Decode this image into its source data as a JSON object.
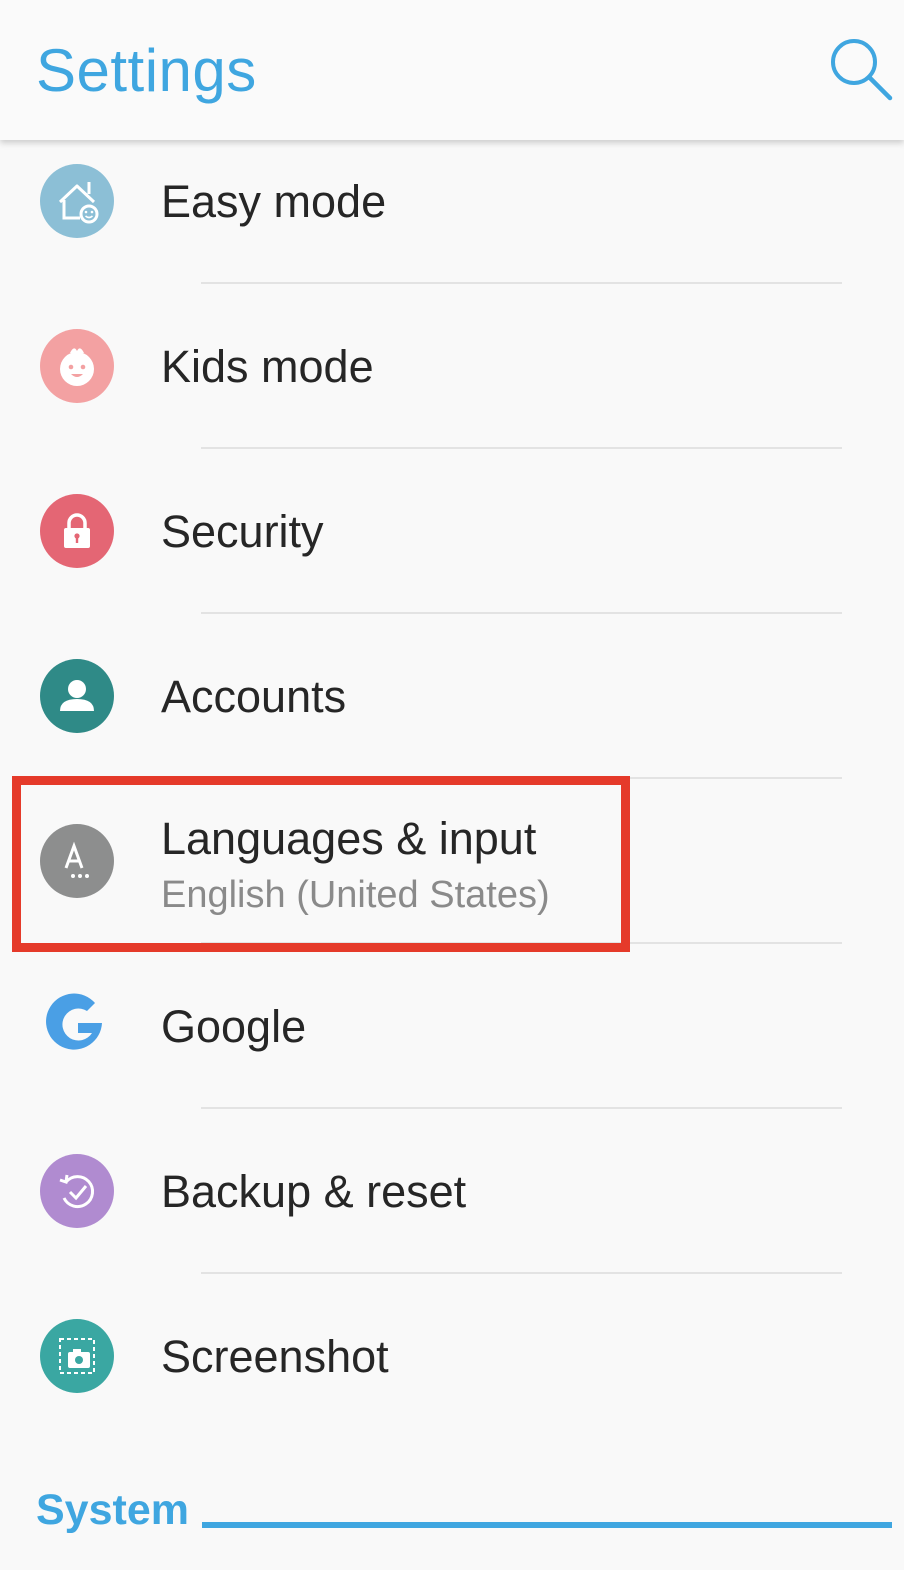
{
  "app_bar": {
    "title": "Settings",
    "search_icon": "search-icon",
    "accent_color": "#3fa6e0"
  },
  "items": [
    {
      "label": "Easy mode",
      "icon": "easy-mode-house-icon",
      "icon_color": "#8cbfd6"
    },
    {
      "label": "Kids mode",
      "icon": "kid-face-icon",
      "icon_color": "#f3a1a2"
    },
    {
      "label": "Security",
      "icon": "lock-icon",
      "icon_color": "#e46674"
    },
    {
      "label": "Accounts",
      "icon": "person-icon",
      "icon_color": "#2f8a87"
    },
    {
      "label": "Languages & input",
      "sublabel": "English (United States)",
      "icon": "language-icon",
      "icon_color": "#8d8e8e",
      "highlighted": true,
      "highlight_color": "#e53a2a"
    },
    {
      "label": "Google",
      "icon": "google-g-icon",
      "icon_color": "#4a9fe5"
    },
    {
      "label": "Backup & reset",
      "icon": "backup-icon",
      "icon_color": "#b08bd0"
    },
    {
      "label": "Screenshot",
      "icon": "screenshot-camera-icon",
      "icon_color": "#3aa7a2"
    }
  ],
  "section": {
    "label": "System"
  }
}
